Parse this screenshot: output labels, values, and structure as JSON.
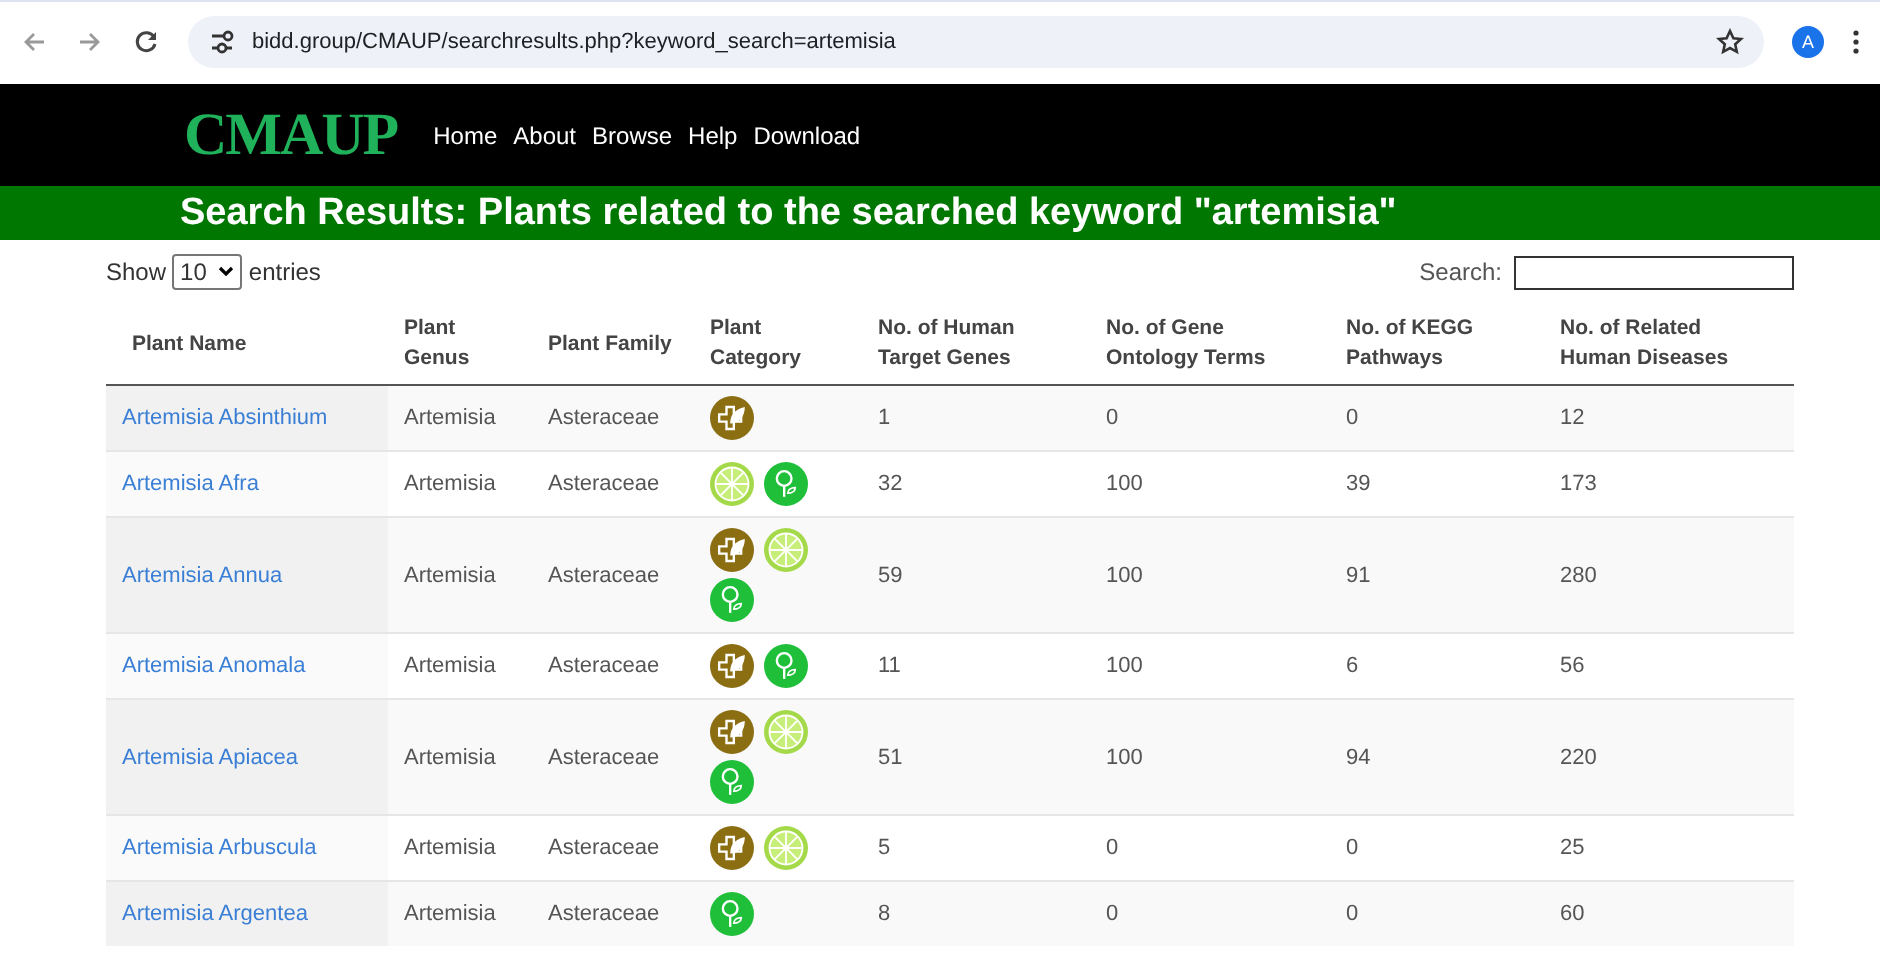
{
  "browser": {
    "url": "bidd.group/CMAUP/searchresults.php?keyword_search=artemisia",
    "profile": "A"
  },
  "header": {
    "logo": "CMAUP",
    "nav": [
      "Home",
      "About",
      "Browse",
      "Help",
      "Download"
    ]
  },
  "banner": {
    "title": "Search Results: Plants related to the searched keyword \"artemisia\""
  },
  "controls": {
    "show_label": "Show",
    "page_size": "10",
    "entries_label": "entries",
    "search_label": "Search:"
  },
  "table": {
    "columns": [
      "Plant Name",
      "Plant Genus",
      "Plant Family",
      "Plant Category",
      "No. of Human Target Genes",
      "No. of Gene Ontology Terms",
      "No. of KEGG Pathways",
      "No. of Related Human Diseases"
    ],
    "rows": [
      {
        "name": "Artemisia Absinthium",
        "genus": "Artemisia",
        "family": "Asteraceae",
        "categories": [
          {
            "kind": "medicinal"
          }
        ],
        "target_genes": "1",
        "go_terms": "0",
        "kegg_pathways": "0",
        "diseases": "12"
      },
      {
        "name": "Artemisia Afra",
        "genus": "Artemisia",
        "family": "Asteraceae",
        "categories": [
          {
            "kind": "food"
          },
          {
            "kind": "plant"
          }
        ],
        "target_genes": "32",
        "go_terms": "100",
        "kegg_pathways": "39",
        "diseases": "173"
      },
      {
        "name": "Artemisia Annua",
        "genus": "Artemisia",
        "family": "Asteraceae",
        "categories": [
          {
            "kind": "medicinal"
          },
          {
            "kind": "food"
          },
          {
            "kind": "plant"
          }
        ],
        "target_genes": "59",
        "go_terms": "100",
        "kegg_pathways": "91",
        "diseases": "280"
      },
      {
        "name": "Artemisia Anomala",
        "genus": "Artemisia",
        "family": "Asteraceae",
        "categories": [
          {
            "kind": "medicinal"
          },
          {
            "kind": "plant"
          }
        ],
        "target_genes": "11",
        "go_terms": "100",
        "kegg_pathways": "6",
        "diseases": "56"
      },
      {
        "name": "Artemisia Apiacea",
        "genus": "Artemisia",
        "family": "Asteraceae",
        "categories": [
          {
            "kind": "medicinal"
          },
          {
            "kind": "food"
          },
          {
            "kind": "plant"
          }
        ],
        "target_genes": "51",
        "go_terms": "100",
        "kegg_pathways": "94",
        "diseases": "220"
      },
      {
        "name": "Artemisia Arbuscula",
        "genus": "Artemisia",
        "family": "Asteraceae",
        "categories": [
          {
            "kind": "medicinal"
          },
          {
            "kind": "food"
          }
        ],
        "target_genes": "5",
        "go_terms": "0",
        "kegg_pathways": "0",
        "diseases": "25"
      },
      {
        "name": "Artemisia Argentea",
        "genus": "Artemisia",
        "family": "Asteraceae",
        "categories": [
          {
            "kind": "plant"
          }
        ],
        "target_genes": "8",
        "go_terms": "0",
        "kegg_pathways": "0",
        "diseases": "60"
      }
    ]
  }
}
